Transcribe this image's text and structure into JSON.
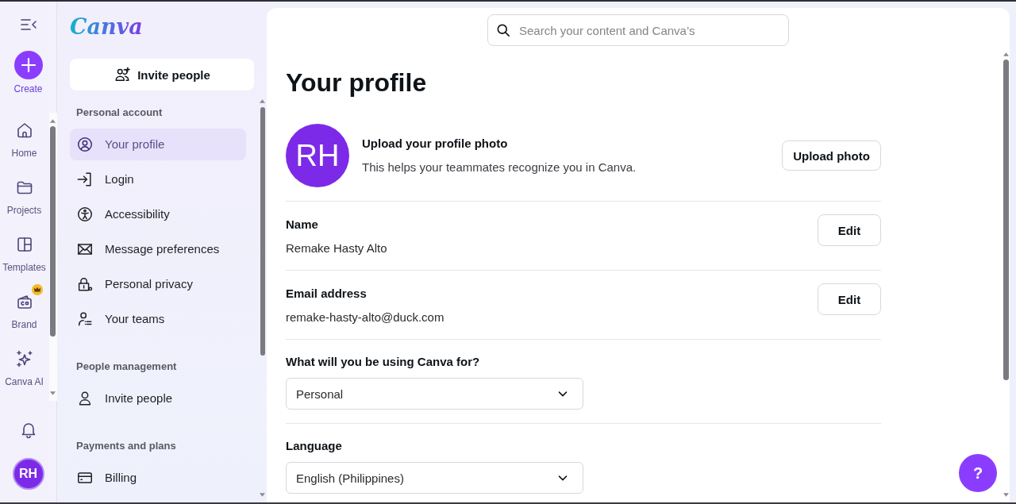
{
  "rail": {
    "create": "Create",
    "items": [
      {
        "label": "Home",
        "selected": false,
        "premium": false
      },
      {
        "label": "Projects",
        "selected": false,
        "premium": false
      },
      {
        "label": "Templates",
        "selected": false,
        "premium": false
      },
      {
        "label": "Brand",
        "selected": false,
        "premium": true
      },
      {
        "label": "Canva AI",
        "selected": false,
        "premium": false
      }
    ],
    "avatar": "RH"
  },
  "sidebar": {
    "logo": "Canva",
    "invite_button": "Invite people",
    "sections": [
      {
        "heading": "Personal account",
        "items": [
          {
            "label": "Your profile",
            "selected": true
          },
          {
            "label": "Login",
            "selected": false
          },
          {
            "label": "Accessibility",
            "selected": false
          },
          {
            "label": "Message preferences",
            "selected": false
          },
          {
            "label": "Personal privacy",
            "selected": false
          },
          {
            "label": "Your teams",
            "selected": false
          }
        ]
      },
      {
        "heading": "People management",
        "items": [
          {
            "label": "Invite people",
            "selected": false
          }
        ]
      },
      {
        "heading": "Payments and plans",
        "items": [
          {
            "label": "Billing",
            "selected": false
          }
        ]
      }
    ]
  },
  "main": {
    "search": {
      "placeholder": "Search your content and Canva’s"
    },
    "title": "Your profile",
    "photo": {
      "initials": "RH",
      "heading": "Upload your profile photo",
      "text": "This helps your teammates recognize you in Canva.",
      "button": "Upload photo"
    },
    "fields": [
      {
        "kind": "text",
        "label": "Name",
        "value": "Remake Hasty Alto",
        "button": "Edit"
      },
      {
        "kind": "text",
        "label": "Email address",
        "value": "remake-hasty-alto@duck.com",
        "button": "Edit"
      },
      {
        "kind": "select",
        "label": "What will you be using Canva for?",
        "value": "Personal"
      },
      {
        "kind": "select",
        "label": "Language",
        "value": "English (Philippines)"
      }
    ],
    "help_button": "?"
  }
}
